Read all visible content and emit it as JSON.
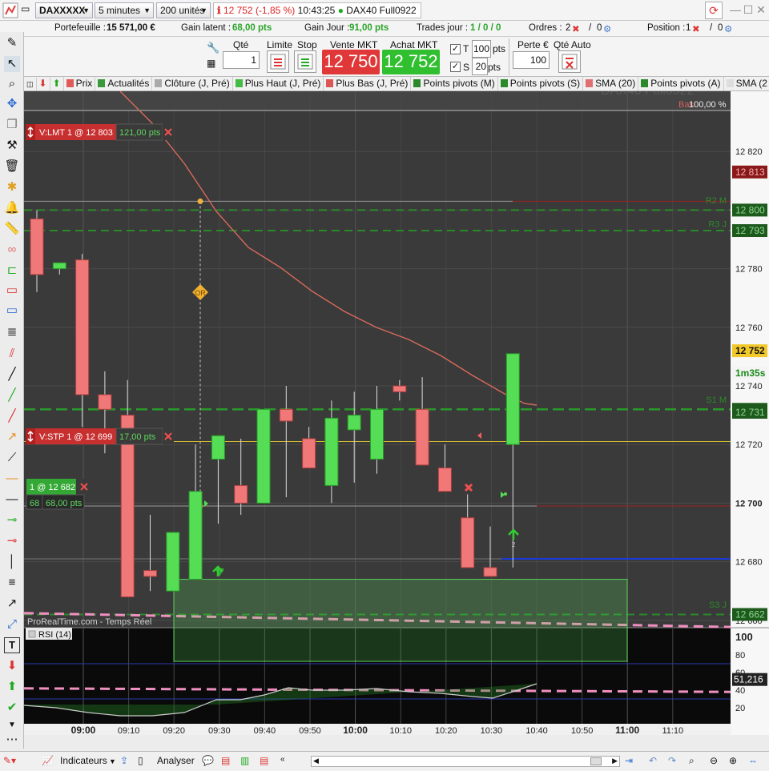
{
  "topbar": {
    "instrument": "DAXXXXX",
    "timeframe": "5 minutes",
    "units": "200 unités",
    "price_change": "12 752 (-1,85 %)",
    "time": "10:43:25",
    "contract": "DAX40 Full0922"
  },
  "info": {
    "portfolio_label": "Portefeuille :",
    "portfolio_value": "15 571,00 €",
    "latent_label": "Gain latent :",
    "latent_value": "68,00 pts",
    "day_label": "Gain Jour :",
    "day_value": "91,00 pts",
    "trades_label": "Trades jour :",
    "trades_value": "1 / 0 / 0",
    "orders_label": "Ordres :",
    "orders_value": "2",
    "orders_value2": "0",
    "position_label": "Position :",
    "position_value": "1",
    "position_value2": "0"
  },
  "order_bar": {
    "qty_label": "Qté",
    "qty_value": "1",
    "limit_label": "Limite",
    "stop_label": "Stop",
    "sell_label": "Vente MKT",
    "sell_price": "12 750",
    "buy_label": "Achat MKT",
    "buy_price": "12 752",
    "t_label": "T",
    "t_value": "100",
    "t_unit": "pts",
    "s_label": "S",
    "s_value": "20",
    "s_unit": "pts",
    "loss_label": "Perte €",
    "loss_value": "100",
    "auto_qty_label": "Qté Auto"
  },
  "indicators": [
    {
      "label": "Prix",
      "color": "#e05a5a"
    },
    {
      "label": "Actualités",
      "color": "#3a9a3a"
    },
    {
      "label": "Clôture (J, Pré)",
      "color": "#aaaaaa"
    },
    {
      "label": "Plus Haut (J, Pré)",
      "color": "#44bb44"
    },
    {
      "label": "Plus Bas (J, Pré)",
      "color": "#dd5555"
    },
    {
      "label": "Points pivots (M)",
      "color": "#2a8a2a"
    },
    {
      "label": "Points pivots (S)",
      "color": "#2a8a2a"
    },
    {
      "label": "SMA (20)",
      "color": "#e07070"
    },
    {
      "label": "Points pivots (A)",
      "color": "#2a8a2a"
    },
    {
      "label": "SMA (2",
      "color": "#dddddd"
    }
  ],
  "chart": {
    "watermark": "DAX40 Full0922",
    "source": "ProRealTime.com - Temps Réel",
    "basket_label": "Bas",
    "basket_pct": "100,00 %",
    "orders": [
      {
        "label": "V:LMT  1 @ 12 803",
        "pts": "121,00 pts",
        "price": 12803
      },
      {
        "label": "V:STP  1 @ 12 699",
        "pts": "17,00 pts",
        "price": 12699
      }
    ],
    "position": {
      "label": "1 @ 12 682",
      "qty": "68",
      "pts": "68,00 pts",
      "price": 12682
    },
    "pivot_labels": [
      "R2 M",
      "R3 J",
      "S1 M",
      "S3 J"
    ],
    "price_tags": [
      {
        "text": "12 813",
        "kind": "darkred"
      },
      {
        "text": "12 800",
        "kind": "darkgreen"
      },
      {
        "text": "12 793",
        "kind": "darkgreen"
      },
      {
        "text": "12 752",
        "kind": "current"
      },
      {
        "text": "1m35s",
        "kind": "timer"
      },
      {
        "text": "12 732",
        "kind": "darkgreen"
      },
      {
        "text": "12 731",
        "kind": "darkgreen"
      },
      {
        "text": "12 662",
        "kind": "darkgreen"
      }
    ],
    "or_marker": "OR",
    "axis": {
      "price_ticks": [
        "12 820",
        "12 800",
        "12 780",
        "12 760",
        "12 740",
        "12 720",
        "12 700",
        "12 680",
        "12 660"
      ],
      "time_ticks": [
        "09:00",
        "09:10",
        "09:20",
        "09:30",
        "09:40",
        "09:50",
        "10:00",
        "10:10",
        "10:20",
        "10:30",
        "10:40",
        "10:50",
        "11:00",
        "11:10"
      ]
    }
  },
  "chart_data": {
    "type": "candlestick",
    "x": [
      "08:55",
      "09:00",
      "09:05",
      "09:10",
      "09:15",
      "09:20",
      "09:25",
      "09:30",
      "09:35",
      "09:40",
      "09:45",
      "09:50",
      "09:55",
      "10:00",
      "10:05",
      "10:10",
      "10:15",
      "10:20",
      "10:25",
      "10:30",
      "10:35",
      "10:40"
    ],
    "open": [
      12797,
      12780,
      12783,
      12737,
      12730,
      12677,
      12670,
      12674,
      12715,
      12706,
      12700,
      12732,
      12722,
      12706,
      12725,
      12715,
      12740,
      12732,
      12712,
      12695,
      12678,
      12720
    ],
    "high": [
      12800,
      12781,
      12785,
      12745,
      12742,
      12696,
      12690,
      12720,
      12722,
      12722,
      12722,
      12740,
      12726,
      12735,
      12738,
      12740,
      12742,
      12743,
      12720,
      12703,
      12692,
      12733
    ],
    "low": [
      12772,
      12778,
      12726,
      12717,
      12718,
      12670,
      12675,
      12690,
      12693,
      12696,
      12716,
      12702,
      12714,
      12700,
      12707,
      12710,
      12735,
      12730,
      12708,
      12695,
      12676,
      12678
    ],
    "close": [
      12778,
      12782,
      12737,
      12732,
      12668,
      12675,
      12690,
      12704,
      12723,
      12700,
      12732,
      12728,
      12712,
      12729,
      12730,
      12732,
      12738,
      12713,
      12704,
      12678,
      12675,
      12751
    ],
    "sma20": {
      "name": "SMA (20)"
    },
    "price_range": [
      12655,
      12825
    ],
    "rsi": {
      "name": "RSI (14)",
      "last": "51,216",
      "range": [
        0,
        100
      ],
      "ticks": [
        "100",
        "80",
        "60",
        "40",
        "20"
      ]
    }
  },
  "bottombar": {
    "indicators_label": "Indicateurs",
    "analyse_label": "Analyser"
  }
}
